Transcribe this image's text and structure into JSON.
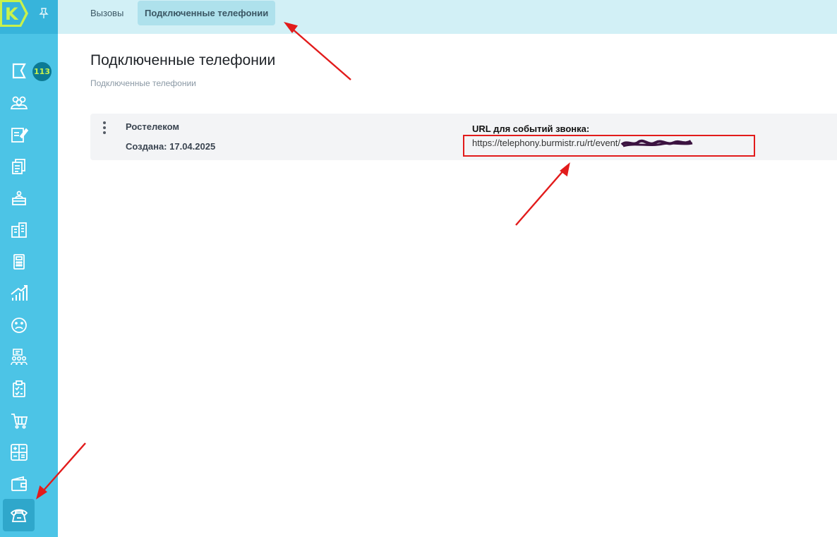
{
  "sidebar": {
    "logo_letter": "K",
    "badge_count": "113",
    "items": [
      {
        "name": "flag-icon"
      },
      {
        "name": "people-icon"
      },
      {
        "name": "edit-doc-icon"
      },
      {
        "name": "documents-icon"
      },
      {
        "name": "reception-icon"
      },
      {
        "name": "building-icon"
      },
      {
        "name": "calculator-icon"
      },
      {
        "name": "growth-chart-icon"
      },
      {
        "name": "sad-face-icon"
      },
      {
        "name": "meeting-icon"
      },
      {
        "name": "clipboard-check-icon"
      },
      {
        "name": "cart-icon"
      },
      {
        "name": "calc-grid-icon"
      },
      {
        "name": "wallet-icon"
      },
      {
        "name": "telephone-icon",
        "active": true
      }
    ]
  },
  "topbar": {
    "tabs": [
      {
        "label": "Вызовы",
        "active": false
      },
      {
        "label": "Подключенные телефонии",
        "active": true
      }
    ]
  },
  "main": {
    "title": "Подключенные телефонии",
    "breadcrumb": "Подключенные телефонии",
    "cards": [
      {
        "provider": "Ростелеком",
        "created": "Создана: 17.04.2025",
        "url_label": "URL для событий звонка:",
        "url_value": "https://telephony.burmistr.ru/rt/event/"
      }
    ]
  },
  "colors": {
    "sidebar": "#4cc4e6",
    "topbar": "#d2f0f6",
    "active_tab": "#aee1ec",
    "annotation": "#e21b1b",
    "logo_green": "#c8f24c"
  }
}
